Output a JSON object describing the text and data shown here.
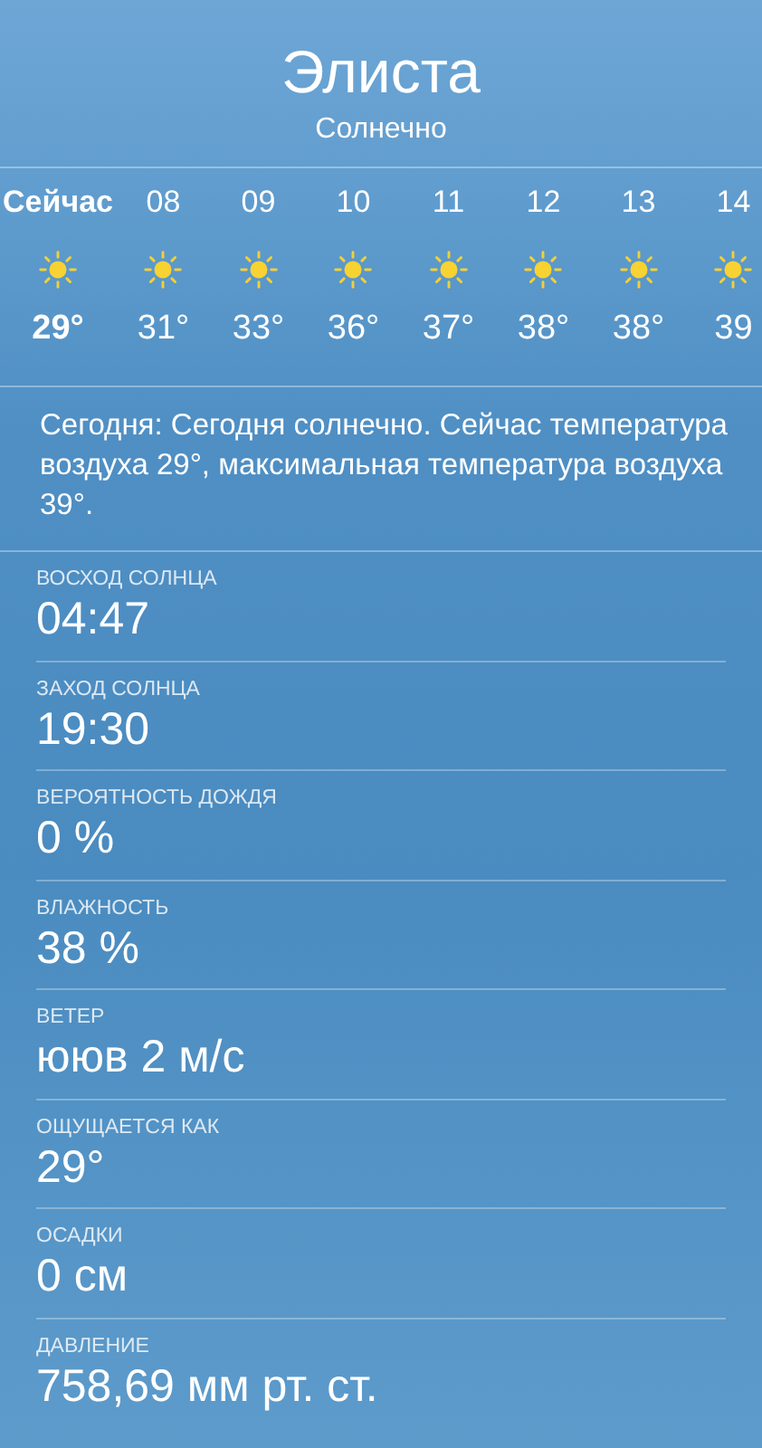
{
  "header": {
    "city": "Элиста",
    "condition": "Солнечно"
  },
  "hourly": [
    {
      "time": "Сейчас",
      "temp": "29°",
      "now": true
    },
    {
      "time": "08",
      "temp": "31°",
      "now": false
    },
    {
      "time": "09",
      "temp": "33°",
      "now": false
    },
    {
      "time": "10",
      "temp": "36°",
      "now": false
    },
    {
      "time": "11",
      "temp": "37°",
      "now": false
    },
    {
      "time": "12",
      "temp": "38°",
      "now": false
    },
    {
      "time": "13",
      "temp": "38°",
      "now": false
    },
    {
      "time": "14",
      "temp": "39",
      "now": false
    }
  ],
  "summary": "Сегодня: Сегодня солнечно. Сейчас температура воздуха 29°, максимальная температура воздуха 39°.",
  "details": [
    {
      "label": "ВОСХОД СОЛНЦА",
      "value": "04:47"
    },
    {
      "label": "ЗАХОД СОЛНЦА",
      "value": "19:30"
    },
    {
      "label": "ВЕРОЯТНОСТЬ ДОЖДЯ",
      "value": "0 %"
    },
    {
      "label": "ВЛАЖНОСТЬ",
      "value": "38 %"
    },
    {
      "label": "ВЕТЕР",
      "value": "ююв 2 м/с"
    },
    {
      "label": "ОЩУЩАЕТСЯ КАК",
      "value": "29°"
    },
    {
      "label": "ОСАДКИ",
      "value": "0 см"
    },
    {
      "label": "ДАВЛЕНИЕ",
      "value": "758,69 мм рт. ст."
    }
  ]
}
